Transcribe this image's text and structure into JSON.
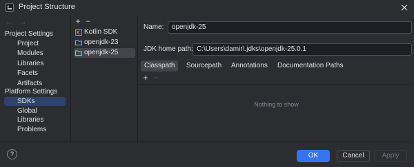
{
  "window": {
    "title": "Project Structure"
  },
  "nav": {
    "back_arrow": "←",
    "forward_arrow": "→",
    "project_settings_header": "Project Settings",
    "project_items": [
      "Project",
      "Modules",
      "Libraries",
      "Facets",
      "Artifacts"
    ],
    "platform_settings_header": "Platform Settings",
    "platform_items": [
      "SDKs",
      "Global Libraries"
    ],
    "problems_label": "Problems",
    "selected_item": "SDKs"
  },
  "sdk_list": {
    "add_symbol": "+",
    "remove_symbol": "−",
    "items": [
      "Kotlin SDK",
      "openjdk-23",
      "openjdk-25"
    ],
    "selected_item": "openjdk-25"
  },
  "details": {
    "name_label": "Name:",
    "name_value": "openjdk-25",
    "home_path_label": "JDK home path:",
    "home_path_value": "C:\\Users\\damir\\.jdks\\openjdk-25.0.1",
    "tabs": [
      "Classpath",
      "Sourcepath",
      "Annotations",
      "Documentation Paths"
    ],
    "active_tab": "Classpath",
    "add_symbol": "+",
    "remove_symbol": "−",
    "empty_text": "Nothing to show"
  },
  "footer": {
    "help_symbol": "?",
    "ok_label": "OK",
    "cancel_label": "Cancel",
    "apply_label": "Apply"
  },
  "colors": {
    "background": "#2b2d30",
    "selection_nav": "#2e436e",
    "selection_list": "#43454a",
    "primary_button": "#3574f0",
    "kotlin_icon": "#a97bff"
  },
  "icons": [
    "app-icon",
    "close-icon",
    "kotlin-sdk-icon",
    "jdk-folder-icon",
    "help-icon"
  ]
}
